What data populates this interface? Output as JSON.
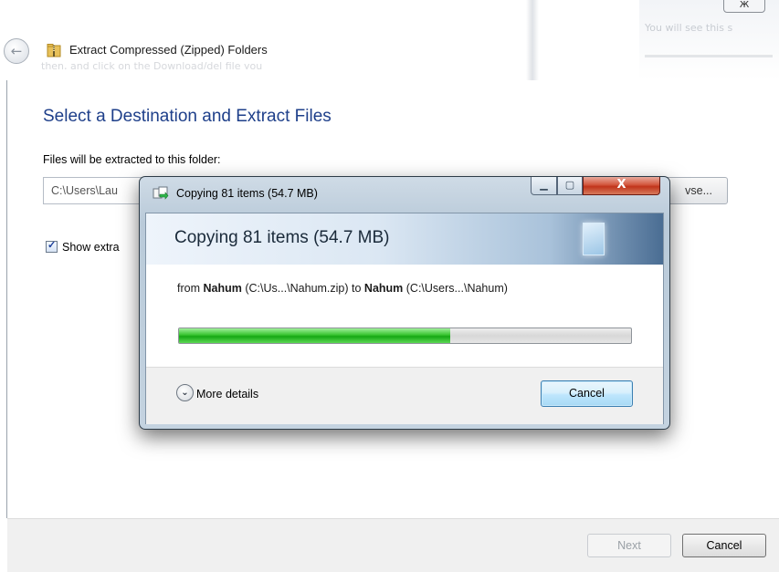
{
  "wizard": {
    "close_glyph": "ж",
    "back_glyph": "←",
    "title": "Extract Compressed (Zipped) Folders",
    "heading": "Select a Destination and Extract Files",
    "folder_label": "Files will be extracted to this folder:",
    "path_value": "C:\\Users\\Lau",
    "browse_label": "vse...",
    "show_label": "Show extra",
    "next_label": "Next",
    "cancel_label": "Cancel",
    "ghost_text_1": "You will see this s",
    "ghost_text_2": "then, and click on the Download/del file you"
  },
  "dialog": {
    "title": "Copying 81 items (54.7 MB)",
    "banner": "Copying 81 items (54.7 MB)",
    "from_prefix": "from ",
    "source_name": "Nahum",
    "source_path": " (C:\\Us...\\Nahum.zip) to ",
    "dest_name": "Nahum",
    "dest_path": " (C:\\Users...\\Nahum)",
    "progress_fraction": 0.6,
    "more_details_label": "More details",
    "more_glyph": "⌄",
    "cancel_label": "Cancel",
    "min_glyph": "▁",
    "max_glyph": "▢",
    "close_glyph": "X"
  },
  "colors": {
    "heading": "#1e3f8a",
    "progress_green": "#16a814",
    "close_red": "#c0341b"
  }
}
